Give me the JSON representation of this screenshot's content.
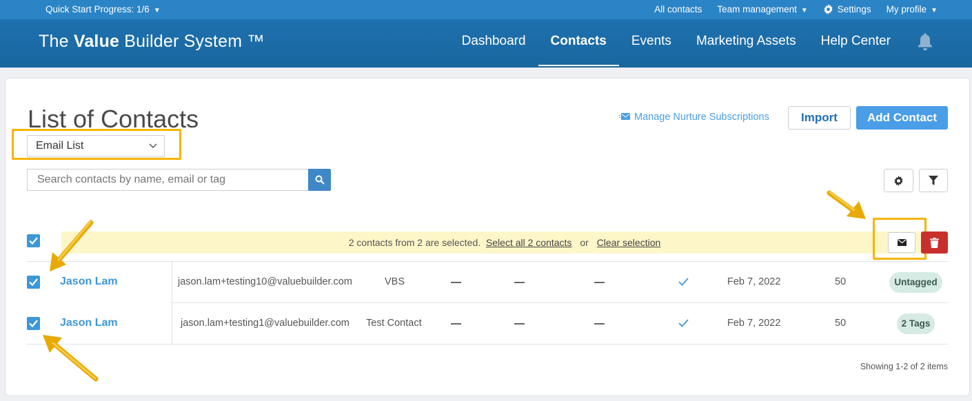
{
  "topbar": {
    "quick_start": "Quick Start Progress: 1/6",
    "links": [
      "All contacts",
      "Team management",
      "Settings",
      "My profile"
    ]
  },
  "nav": {
    "brand_pre": "The ",
    "brand_bold": "Value",
    "brand_post": " Builder System ™",
    "items": [
      "Dashboard",
      "Contacts",
      "Events",
      "Marketing Assets",
      "Help Center"
    ],
    "active": "Contacts"
  },
  "page": {
    "title": "List of Contacts",
    "list_select": "Email List",
    "manage_link": "Manage Nurture Subscriptions",
    "import_label": "Import",
    "add_label": "Add Contact",
    "search_placeholder": "Search contacts by name, email or tag"
  },
  "selection": {
    "message": "2 contacts from 2 are selected.",
    "select_all": "Select all 2 contacts",
    "or": "or",
    "clear": "Clear selection"
  },
  "contacts": [
    {
      "name": "Jason Lam",
      "email": "jason.lam+testing10@valuebuilder.com",
      "type": "VBS",
      "date": "Feb 7, 2022",
      "score": "50",
      "tag": "Untagged"
    },
    {
      "name": "Jason Lam",
      "email": "jason.lam+testing1@valuebuilder.com",
      "type": "Test Contact",
      "date": "Feb 7, 2022",
      "score": "50",
      "tag": "2 Tags"
    }
  ],
  "footer": {
    "showing": "Showing 1-2 of 2 items"
  },
  "colors": {
    "topbar": "#2b84c6",
    "nav": "#1d70ae",
    "accent": "#4a9ee7",
    "highlight": "#f5b400",
    "delete": "#c9302c",
    "selection_bar": "#fdf6c8"
  }
}
